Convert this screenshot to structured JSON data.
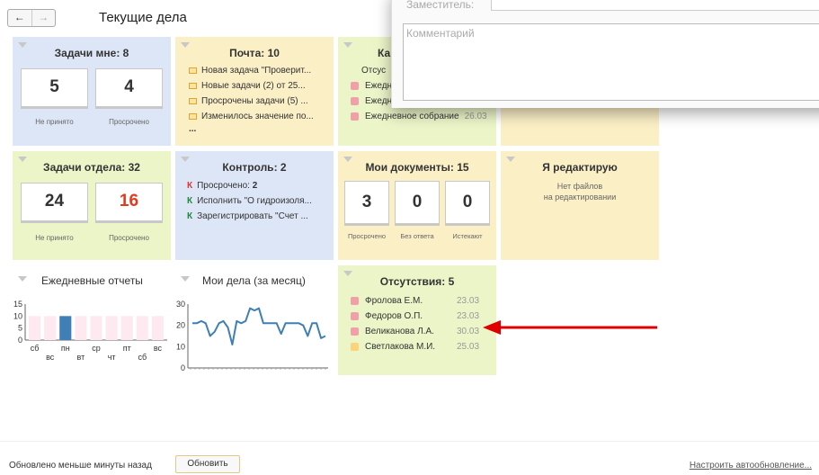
{
  "header": {
    "title": "Текущие дела",
    "back": "←",
    "forward": "→"
  },
  "dialog": {
    "deputy_label": "Заместитель:",
    "comment_placeholder": "Комментарий"
  },
  "tiles": {
    "my_tasks": {
      "title": "Задачи мне: 8",
      "not_accepted_value": "5",
      "overdue_value": "4",
      "not_accepted_label": "Не принято",
      "overdue_label": "Просрочено"
    },
    "mail": {
      "title": "Почта: 10",
      "items": [
        "Новая задача \"Проверит...",
        "Новые задачи (2) от 25...",
        "Просрочены задачи (5) ...",
        "Изменилось значение по..."
      ],
      "more": "..."
    },
    "calendar": {
      "title": "Ка",
      "subtitle": "Отсус",
      "items": [
        "Ежедн",
        "Ежедн",
        "Ежедневное собрание"
      ],
      "last_date": "26.03"
    },
    "dept_tasks": {
      "title": "Задачи отдела: 32",
      "not_accepted_value": "24",
      "overdue_value": "16",
      "not_accepted_label": "Не принято",
      "overdue_label": "Просрочено"
    },
    "control": {
      "title": "Контроль: 2",
      "items": [
        {
          "mark": "К",
          "text": "Просрочено:",
          "value": "2"
        },
        {
          "mark": "К",
          "text": "Исполнить \"О гидроизоля..."
        },
        {
          "mark": "К",
          "text": "Зарегистрировать \"Счет ..."
        }
      ]
    },
    "my_docs": {
      "title": "Мои документы: 15",
      "v1": "3",
      "v2": "0",
      "v3": "0",
      "l1": "Просрочено",
      "l2": "Без ответа",
      "l3": "Истекают"
    },
    "editing": {
      "title": "Я редактирую",
      "line1": "Нет файлов",
      "line2": "на редактировании"
    },
    "daily_reports": {
      "title": "Ежедневные отчеты"
    },
    "my_affairs": {
      "title": "Мои дела (за месяц)"
    },
    "absences": {
      "title": "Отсутствия: 5",
      "items": [
        {
          "name": "Фролова Е.М.",
          "date": "23.03",
          "color": "#f0a0a8"
        },
        {
          "name": "Федоров О.П.",
          "date": "23.03",
          "color": "#f0a0a8"
        },
        {
          "name": "Великанова Л.А.",
          "date": "30.03",
          "color": "#f0a0a8"
        },
        {
          "name": "Светлакова М.И.",
          "date": "25.03",
          "color": "#fbd37a"
        }
      ]
    }
  },
  "chart_data": [
    {
      "type": "bar",
      "title": "Ежедневные отчеты",
      "x_tick_labels": [
        "сб",
        "вс",
        "пн",
        "вт",
        "ср",
        "чт",
        "пт",
        "сб",
        "вс"
      ],
      "categories": [
        "сб",
        "вс",
        "пн",
        "вт",
        "ср",
        "чт",
        "пт",
        "сб",
        "вс"
      ],
      "values": [
        0,
        0,
        10,
        0,
        0,
        0,
        0,
        0,
        0
      ],
      "background_values": [
        10,
        10,
        10,
        10,
        10,
        10,
        10,
        10,
        10
      ],
      "y_ticks": [
        0,
        5,
        10,
        15
      ],
      "ylim": [
        0,
        15
      ]
    },
    {
      "type": "line",
      "title": "Мои дела (за месяц)",
      "y_ticks": [
        0,
        10,
        20,
        30
      ],
      "ylim": [
        0,
        30
      ],
      "values": [
        21,
        21,
        22,
        21,
        15,
        17,
        21,
        22,
        19,
        11,
        22,
        21,
        22,
        28,
        27,
        28,
        21,
        21,
        21,
        21,
        16,
        21,
        21,
        21,
        21,
        20,
        15,
        21,
        21,
        14,
        15
      ]
    }
  ],
  "footer": {
    "status": "Обновлено меньше минуты назад",
    "refresh_label": "Обновить",
    "autoupdate_link": "Настроить автообновление..."
  },
  "colors": {
    "arrow": "#e00000",
    "bar_highlight": "#3f7fb5",
    "bar_bg": "#fde9ef",
    "overdue_value": "#e23a1e",
    "control_mark_red": "#d33",
    "control_mark_green": "#1a8a3a"
  }
}
